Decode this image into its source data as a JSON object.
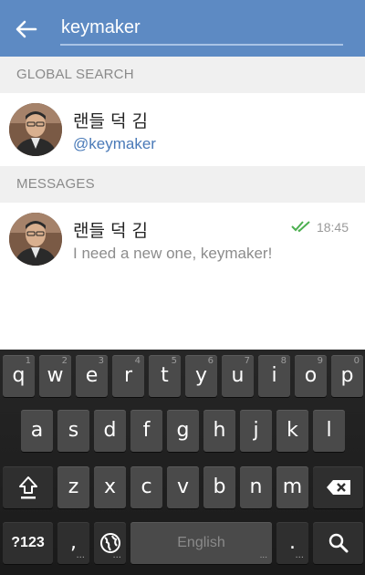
{
  "search": {
    "query": "keymaker"
  },
  "sections": {
    "global": "GLOBAL SEARCH",
    "messages": "MESSAGES"
  },
  "global_result": {
    "name": "랜들 덕 김",
    "username": "@keymaker"
  },
  "message_result": {
    "name": "랜들 덕 김",
    "preview": "I need a new one, keymaker!",
    "time": "18:45",
    "status_icon": "double-check-icon"
  },
  "keyboard": {
    "row1": [
      {
        "k": "q",
        "h": "1"
      },
      {
        "k": "w",
        "h": "2"
      },
      {
        "k": "e",
        "h": "3"
      },
      {
        "k": "r",
        "h": "4"
      },
      {
        "k": "t",
        "h": "5"
      },
      {
        "k": "y",
        "h": "6"
      },
      {
        "k": "u",
        "h": "7"
      },
      {
        "k": "i",
        "h": "8"
      },
      {
        "k": "o",
        "h": "9"
      },
      {
        "k": "p",
        "h": "0"
      }
    ],
    "row2": [
      "a",
      "s",
      "d",
      "f",
      "g",
      "h",
      "j",
      "k",
      "l"
    ],
    "row3": [
      "z",
      "x",
      "c",
      "v",
      "b",
      "n",
      "m"
    ],
    "symbols_label": "?123",
    "comma_label": ",",
    "space_label": "English",
    "period_label": "."
  },
  "colors": {
    "header": "#5d8ac3",
    "link": "#4a7ab8",
    "check": "#4caf50"
  }
}
